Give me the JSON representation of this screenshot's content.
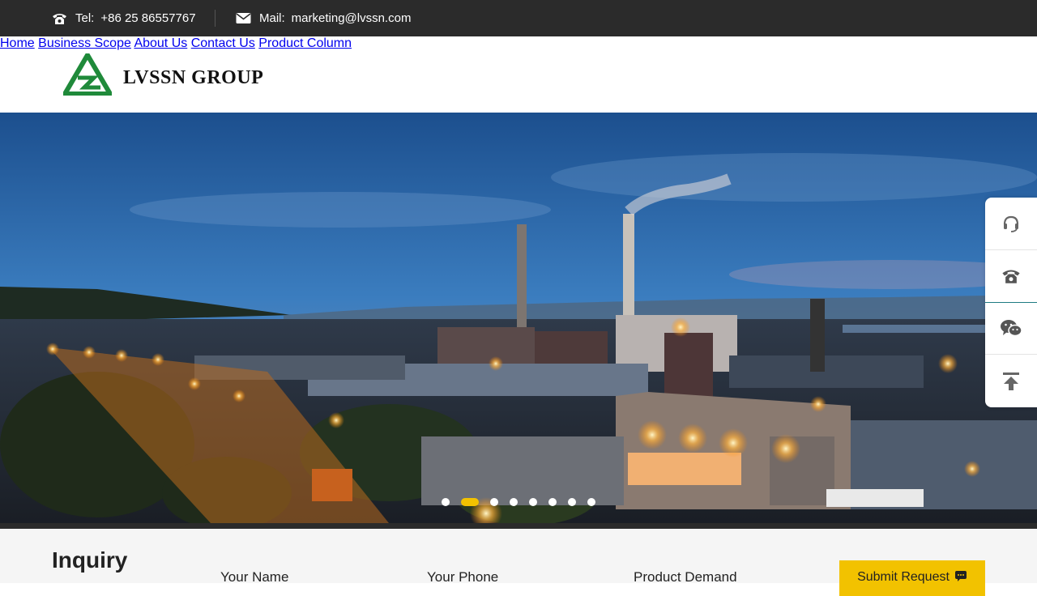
{
  "topbar": {
    "tel_label": "Tel:",
    "tel_value": "+86 25 86557767",
    "mail_label": "Mail:",
    "mail_value": "marketing@lvssn.com",
    "tel_icon": "phone-icon",
    "mail_icon": "envelope-icon"
  },
  "header": {
    "logo_text": "LVSSN GROUP",
    "brand_color": "#1f8a3a",
    "nav": [
      "Home",
      "Business Scope",
      "About Us",
      "Contact Us",
      "Product Column"
    ]
  },
  "hero": {
    "slide_count": 8,
    "active_slide": 2,
    "active_color": "#f2c200"
  },
  "sidebar": {
    "buttons": [
      "headset-icon",
      "phone-icon",
      "wechat-icon",
      "back-to-top-icon"
    ]
  },
  "inquiry": {
    "title": "Inquiry",
    "fields": [
      "Your Name",
      "Your Phone",
      "Product Demand"
    ],
    "submit_label": "Submit Request",
    "submit_icon": "chat-icon",
    "submit_color": "#f2c200"
  }
}
